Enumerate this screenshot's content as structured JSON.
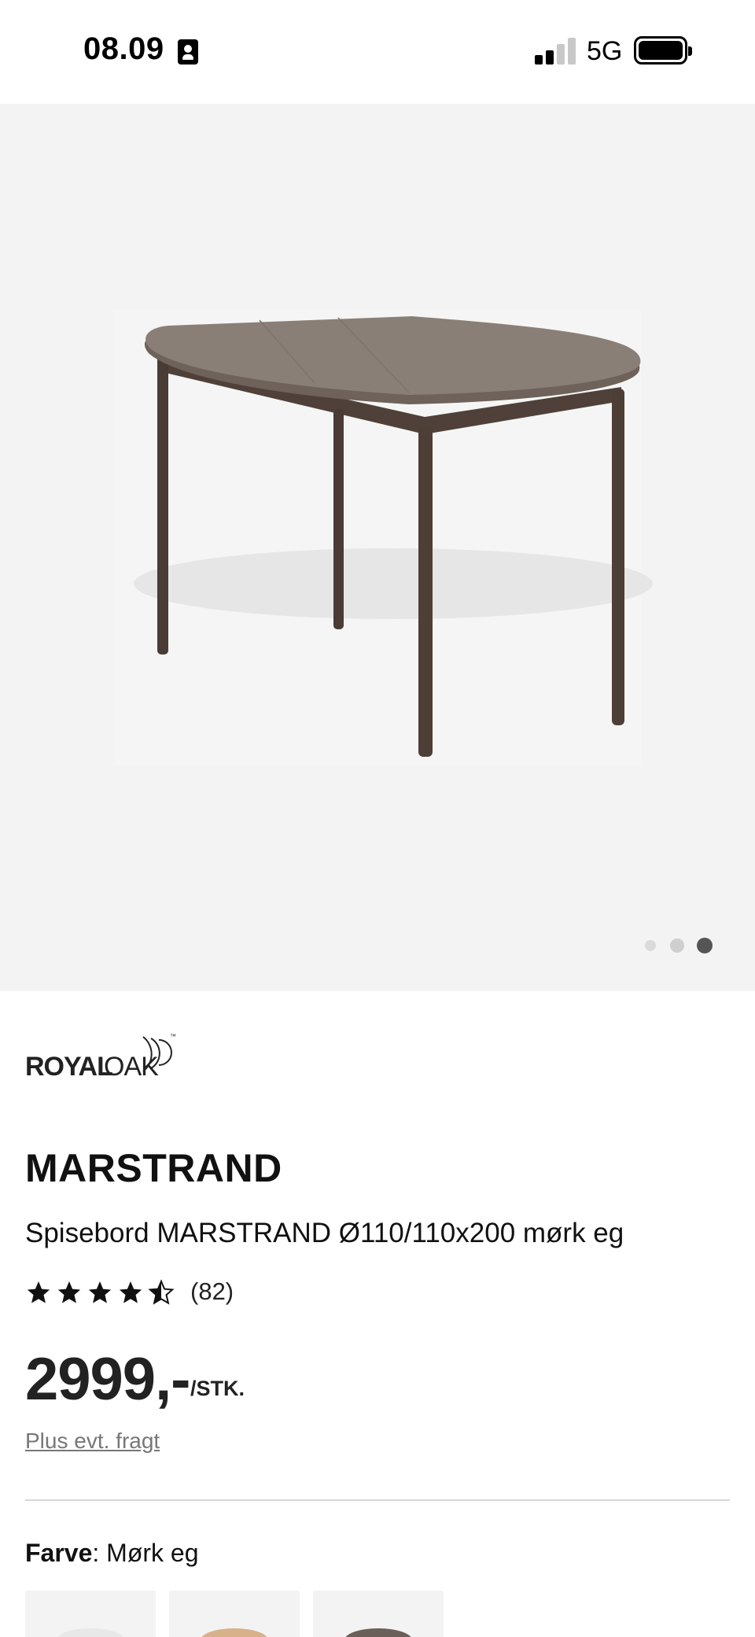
{
  "status_bar": {
    "time": "08.09",
    "network": "5G",
    "icons": [
      "id-card-icon",
      "signal-icon",
      "battery-icon"
    ]
  },
  "gallery": {
    "image": "dining-table-dark-oak",
    "slide_count": 3,
    "active_slide": 3
  },
  "brand": {
    "logo_text_bold": "ROYAL",
    "logo_text_light": "OAK",
    "trademark": "™"
  },
  "product": {
    "title": "MARSTRAND",
    "subtitle": "Spisebord MARSTRAND Ø110/110x200 mørk eg",
    "rating": 4.5,
    "rating_count": "(82)",
    "price": "2999,-",
    "price_unit": "/STK.",
    "shipping_link": "Plus evt. fragt"
  },
  "color": {
    "label": "Farve",
    "value": ": Mørk eg",
    "swatches": [
      {
        "name": "white",
        "color": "#e8e8e8"
      },
      {
        "name": "natural-oak",
        "color": "#d8b08a"
      },
      {
        "name": "dark-oak",
        "color": "#6a6059"
      }
    ]
  },
  "colors": {
    "page_bg": "#ffffff",
    "gallery_bg": "#f3f3f3",
    "text": "#111111",
    "muted": "#777777",
    "divider": "#d6d6d6",
    "table_top": "#8a7f77",
    "table_legs": "#4f4139"
  }
}
